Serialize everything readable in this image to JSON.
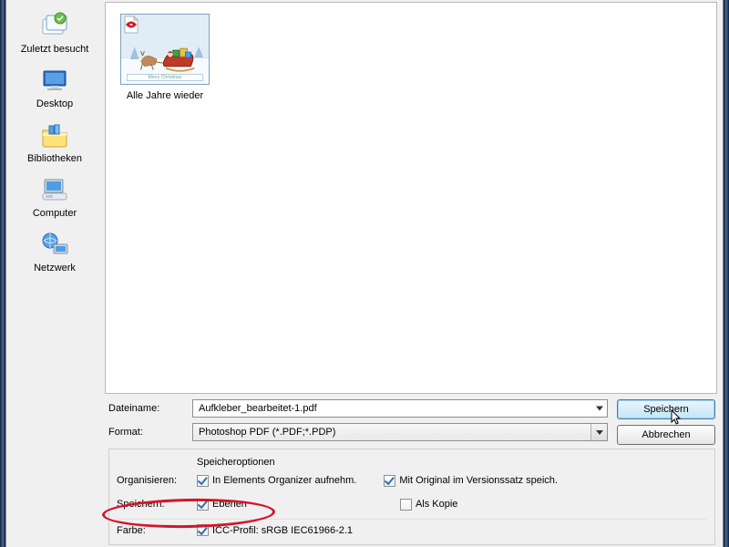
{
  "sidebar": {
    "items": [
      {
        "id": "recent",
        "label": "Zuletzt besucht"
      },
      {
        "id": "desktop",
        "label": "Desktop"
      },
      {
        "id": "libraries",
        "label": "Bibliotheken"
      },
      {
        "id": "computer",
        "label": "Computer"
      },
      {
        "id": "network",
        "label": "Netzwerk"
      }
    ]
  },
  "file_pane": {
    "items": [
      {
        "label": "Alle Jahre wieder",
        "badge": "pdf"
      }
    ]
  },
  "fields": {
    "filename_label": "Dateiname:",
    "filename_value": "Aufkleber_bearbeitet-1.pdf",
    "format_label": "Format:",
    "format_value": "Photoshop PDF (*.PDF;*.PDP)"
  },
  "buttons": {
    "save": "Speichern",
    "cancel": "Abbrechen"
  },
  "options": {
    "title": "Speicheroptionen",
    "organize_label": "Organisieren:",
    "organize_opt1": "In Elements Organizer aufnehm.",
    "organize_opt2": "Mit Original im Versionssatz speich.",
    "save_label": "Speichern:",
    "save_opt1": "Ebenen",
    "save_opt2": "Als Kopie",
    "color_label": "Farbe:",
    "color_opt1": "ICC-Profil: sRGB IEC61966-2.1"
  }
}
